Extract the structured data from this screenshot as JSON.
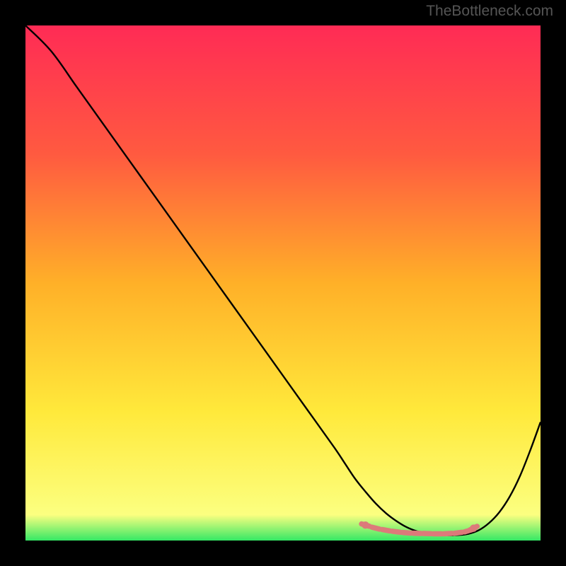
{
  "watermark": "TheBottleneck.com",
  "chart_data": {
    "type": "line",
    "title": "",
    "xlabel": "",
    "ylabel": "",
    "xlim": [
      0,
      100
    ],
    "ylim": [
      0,
      100
    ],
    "gradient_background": {
      "orientation": "vertical",
      "stops": [
        {
          "offset": 0,
          "color": "#ff2b55"
        },
        {
          "offset": 0.25,
          "color": "#ff5a40"
        },
        {
          "offset": 0.5,
          "color": "#ffb028"
        },
        {
          "offset": 0.75,
          "color": "#ffe93b"
        },
        {
          "offset": 0.95,
          "color": "#fcff80"
        },
        {
          "offset": 1.0,
          "color": "#35e865"
        }
      ]
    },
    "series": [
      {
        "name": "bottleneck-curve",
        "color": "#000000",
        "x": [
          0,
          5,
          10,
          15,
          20,
          25,
          30,
          35,
          40,
          45,
          50,
          55,
          60,
          62,
          64,
          66,
          68,
          70,
          72,
          74,
          76,
          78,
          80,
          82,
          84,
          86,
          88,
          90,
          92,
          94,
          96,
          98,
          100
        ],
        "y": [
          100,
          95,
          88,
          81,
          74,
          67,
          60,
          53,
          46,
          39,
          32,
          25,
          18,
          15,
          12,
          9.5,
          7.2,
          5.3,
          3.8,
          2.6,
          1.8,
          1.3,
          1.05,
          1.0,
          1.05,
          1.3,
          2.0,
          3.4,
          5.5,
          8.5,
          12.5,
          17.5,
          23
        ]
      }
    ],
    "emphasis_markers": {
      "color": "#dc7a7a",
      "style": "dashed-beads",
      "x": [
        66,
        68,
        70,
        72,
        74,
        76,
        78,
        80,
        82,
        84,
        86,
        87
      ],
      "y": [
        3.0,
        2.4,
        2.0,
        1.7,
        1.5,
        1.4,
        1.35,
        1.3,
        1.35,
        1.5,
        1.9,
        2.4
      ]
    }
  }
}
